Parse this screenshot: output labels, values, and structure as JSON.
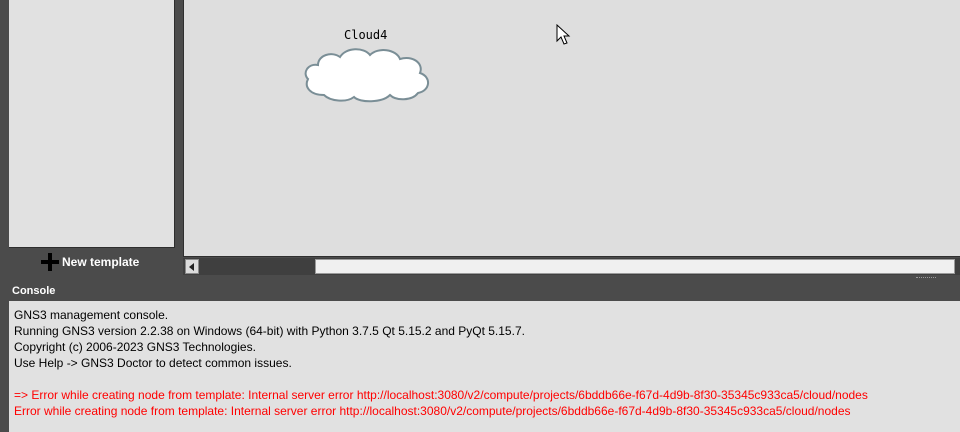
{
  "templates_panel": {
    "new_template_label": "New template"
  },
  "canvas": {
    "nodes": [
      {
        "label": "Cloud4",
        "icon": "cloud-icon"
      }
    ]
  },
  "console": {
    "title": "Console",
    "lines": [
      {
        "text": "GNS3 management console.",
        "kind": "info"
      },
      {
        "text": "Running GNS3 version 2.2.38 on Windows (64-bit) with Python 3.7.5 Qt 5.15.2 and PyQt 5.15.7.",
        "kind": "info"
      },
      {
        "text": "Copyright (c) 2006-2023 GNS3 Technologies.",
        "kind": "info"
      },
      {
        "text": "Use Help -> GNS3 Doctor to detect common issues.",
        "kind": "info"
      },
      {
        "text": "",
        "kind": "blank"
      },
      {
        "text": "=> Error while creating node from template: Internal server error http://localhost:3080/v2/compute/projects/6bddb66e-f67d-4d9b-8f30-35345c933ca5/cloud/nodes",
        "kind": "error"
      },
      {
        "text": "Error while creating node from template: Internal server error http://localhost:3080/v2/compute/projects/6bddb66e-f67d-4d9b-8f30-35345c933ca5/cloud/nodes",
        "kind": "error"
      }
    ]
  },
  "colors": {
    "dock_background": "#4b4b4b",
    "canvas_background": "#dedede",
    "console_background": "#e1e1e1",
    "error_text": "#ff0000",
    "cloud_fill": "#ffffff",
    "cloud_stroke": "#7a8e96"
  }
}
